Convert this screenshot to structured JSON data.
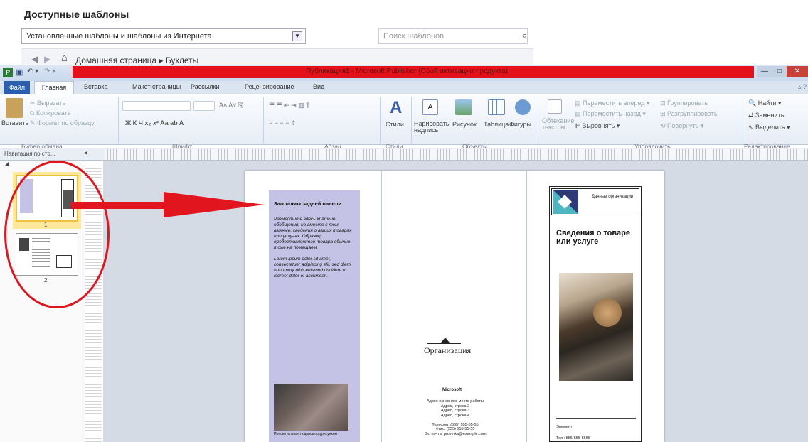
{
  "templates": {
    "title": "Доступные шаблоны",
    "source_select": "Установленные шаблоны и шаблоны из Интернета",
    "search_placeholder": "Поиск шаблонов",
    "breadcrumb": "Домашняя страница ▸ Буклеты"
  },
  "window": {
    "title": "Публикация1 - Microsoft Publisher (Сбой активации продукта)",
    "app_icon_letter": "P"
  },
  "tabs": [
    "Файл",
    "Главная",
    "Вставка",
    "Макет страницы",
    "Рассылки",
    "Рецензирование",
    "Вид"
  ],
  "ribbon": {
    "clipboard": {
      "paste": "Вставить",
      "cut": "Вырезать",
      "copy": "Копировать",
      "format_painter": "Формат по образцу",
      "label": "Буфер обмена"
    },
    "font": {
      "label": "Шрифт"
    },
    "paragraph": {
      "label": "Абзац"
    },
    "styles": {
      "styles_btn": "Стили",
      "label": "Стили"
    },
    "objects": {
      "draw_text": "Нарисовать надпись",
      "picture": "Рисунок",
      "table": "Таблица",
      "shapes": "Фигуры",
      "label": "Объекты"
    },
    "arrange": {
      "wrap": "Обтекание текстом",
      "bring_forward": "Переместить вперед",
      "send_backward": "Переместить назад",
      "align": "Выровнять",
      "group": "Группировать",
      "ungroup": "Разгруппировать",
      "rotate": "Повернуть",
      "label": "Упорядочить"
    },
    "editing": {
      "find": "Найти",
      "replace": "Заменить",
      "select": "Выделить",
      "label": "Редактирование"
    }
  },
  "nav_pane": {
    "title": "Навигация по стр...",
    "page1": "1",
    "page2": "2"
  },
  "document": {
    "panel_heading": "Заголовок задней панели",
    "panel_body_1": "Разместите здесь краткие обобщения, но вместе с тем важные, сведения о ваших товарах или услугах. Образец предоставленного товара обычно тоже на помещаем.",
    "panel_body_2": "Lorem ipsum dolor sit amet, consectetuer adipiscing elit, sed diem nonummy nibh euismod tincidunt ut lacreet dolor et accumsan.",
    "photo_caption": "Пояснительная подпись под рисунком",
    "org_name": "Организация",
    "ms_label": "Microsoft",
    "address": "Адрес основного места работы\nАдрес, строка 2\nАдрес, строка 3\nАдрес, строка 4\n\nТелефон: (555) 555-55-55\nФакс: (555) 555-55-55\nЭл. почта: proverka@example.com",
    "logo_text": "Данные организации",
    "right_title": "Сведения о товаре или услуге",
    "right_addr": "Элемент",
    "right_tel": "Тел.: 555-555-5555"
  },
  "colors": {
    "title_red": "#e4111a",
    "annotation_red": "#e0151d",
    "panel_lilac": "#c5c3e5",
    "logo_navy": "#2e3a78",
    "logo_teal": "#4db6c0"
  }
}
